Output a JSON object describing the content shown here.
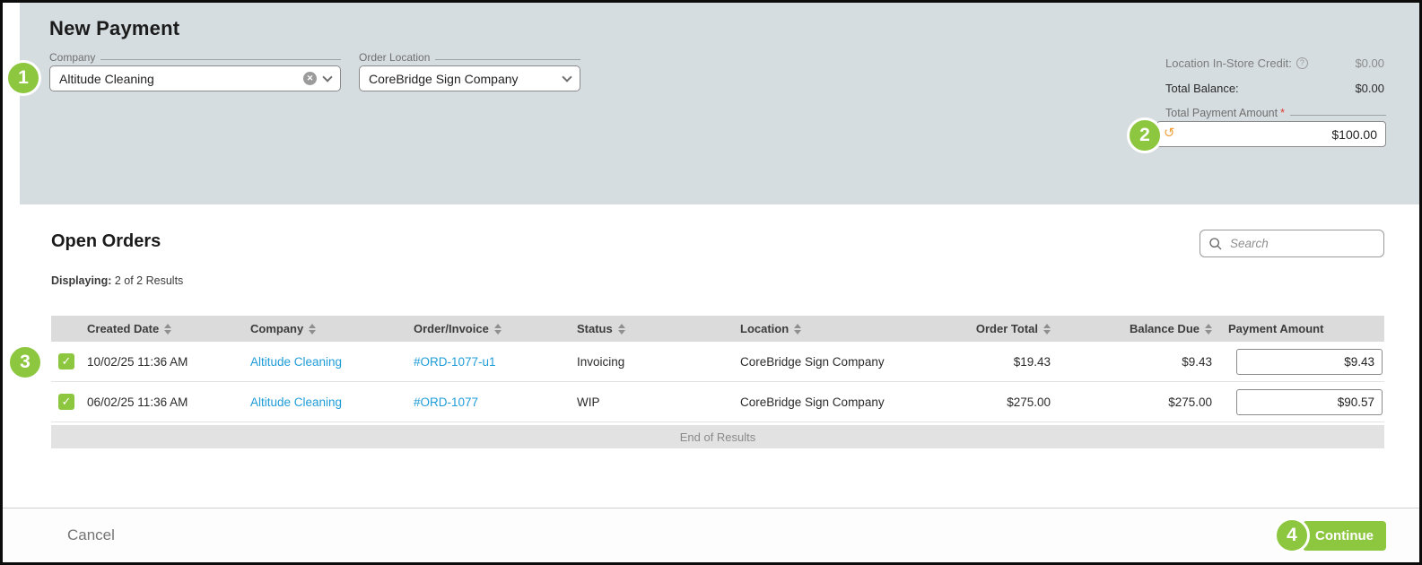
{
  "colors": {
    "accent_green": "#8DC63F",
    "panel_bg": "#D6DDE0",
    "link_blue": "#1E9CD8",
    "required_red": "#E03C31",
    "undo_orange": "#F0A13C"
  },
  "annotations": {
    "step1": "1",
    "step2": "2",
    "step3": "3",
    "step4": "4"
  },
  "header": {
    "title": "New Payment"
  },
  "form": {
    "company_label": "Company",
    "company_value": "Altitude Cleaning",
    "order_location_label": "Order Location",
    "order_location_value": "CoreBridge Sign Company",
    "credit_label": "Location In-Store Credit:",
    "credit_value": "$0.00",
    "total_balance_label": "Total Balance:",
    "total_balance_value": "$0.00",
    "total_payment_label": "Total Payment Amount",
    "required_mark": "*",
    "total_payment_value": "$100.00"
  },
  "orders": {
    "title": "Open Orders",
    "displaying_label": "Displaying:",
    "displaying_value": "2 of 2 Results",
    "search_placeholder": "Search",
    "columns": [
      "Created Date",
      "Company",
      "Order/Invoice",
      "Status",
      "Location",
      "Order Total",
      "Balance Due",
      "Payment Amount"
    ],
    "rows": [
      {
        "checked": true,
        "created_date": "10/02/25 11:36 AM",
        "company": "Altitude Cleaning",
        "order_invoice": "#ORD-1077-u1",
        "status": "Invoicing",
        "location": "CoreBridge Sign Company",
        "order_total": "$19.43",
        "balance_due": "$9.43",
        "payment_amount": "$9.43"
      },
      {
        "checked": true,
        "created_date": "06/02/25 11:36 AM",
        "company": "Altitude Cleaning",
        "order_invoice": "#ORD-1077",
        "status": "WIP",
        "location": "CoreBridge Sign Company",
        "order_total": "$275.00",
        "balance_due": "$275.00",
        "payment_amount": "$90.57"
      }
    ],
    "end_of_results": "End of Results"
  },
  "footer": {
    "cancel_label": "Cancel",
    "continue_label": "Continue"
  },
  "icons": {
    "check": "✓",
    "clear": "✕",
    "undo": "↺",
    "help": "?"
  }
}
